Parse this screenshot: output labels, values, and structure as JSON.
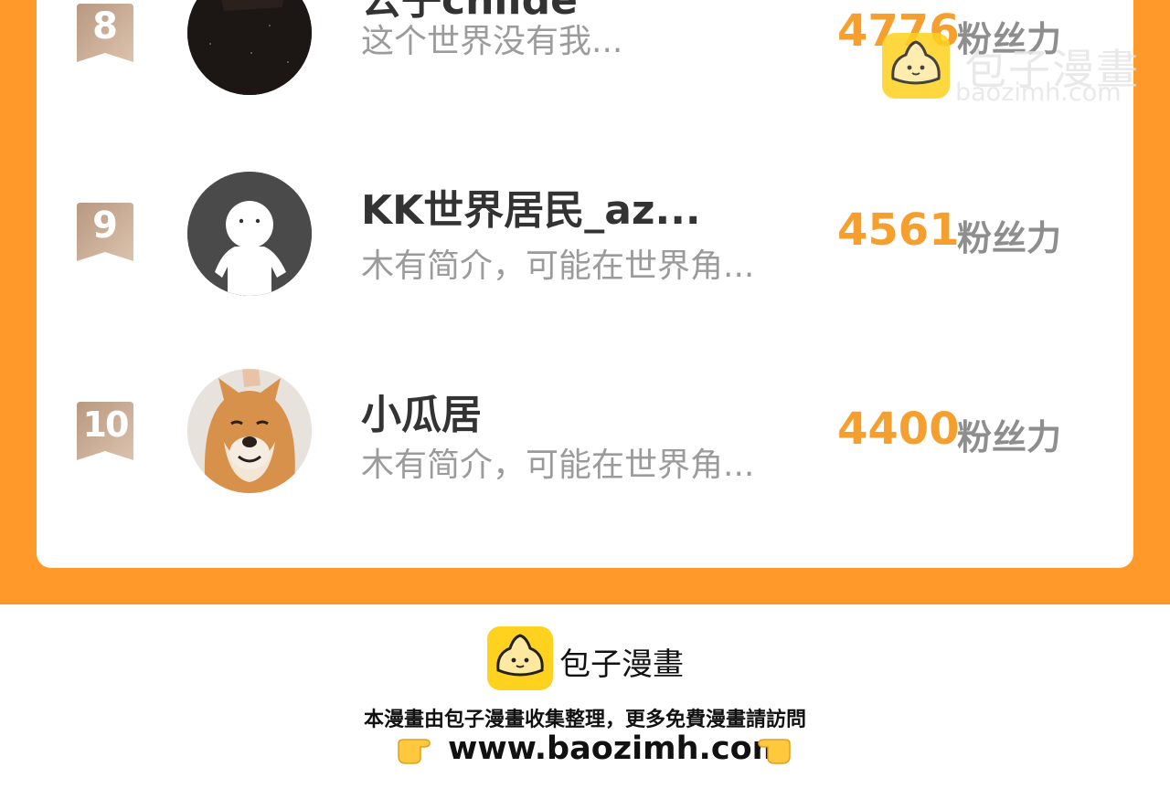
{
  "ranking": {
    "rows": [
      {
        "rank": "8",
        "name": "公子childe",
        "bio": "这个世界没有我...",
        "fans": "4776",
        "fans_unit": "粉丝力"
      },
      {
        "rank": "9",
        "name": "KK世界居民_az...",
        "bio": "木有简介，可能在世界角...",
        "fans": "4561",
        "fans_unit": "粉丝力"
      },
      {
        "rank": "10",
        "name": "小瓜居",
        "bio": "木有简介，可能在世界角...",
        "fans": "4400",
        "fans_unit": "粉丝力"
      }
    ]
  },
  "watermark": {
    "title": "包子漫畫",
    "url": "baozimh.com",
    "icon": "baozi-logo-icon"
  },
  "footer": {
    "brand": "包子漫畫",
    "note": "本漫畫由包子漫畫收集整理，更多免費漫畫請訪問",
    "url": "www.baozimh.com",
    "icons": [
      "pointing-right-hand-icon",
      "pointing-left-hand-icon"
    ]
  },
  "colors": {
    "frame": "#FF9A2A",
    "fans_number": "#F5A02E",
    "badge": "#C9A78C",
    "logo_yellow": "#FFD21F"
  }
}
